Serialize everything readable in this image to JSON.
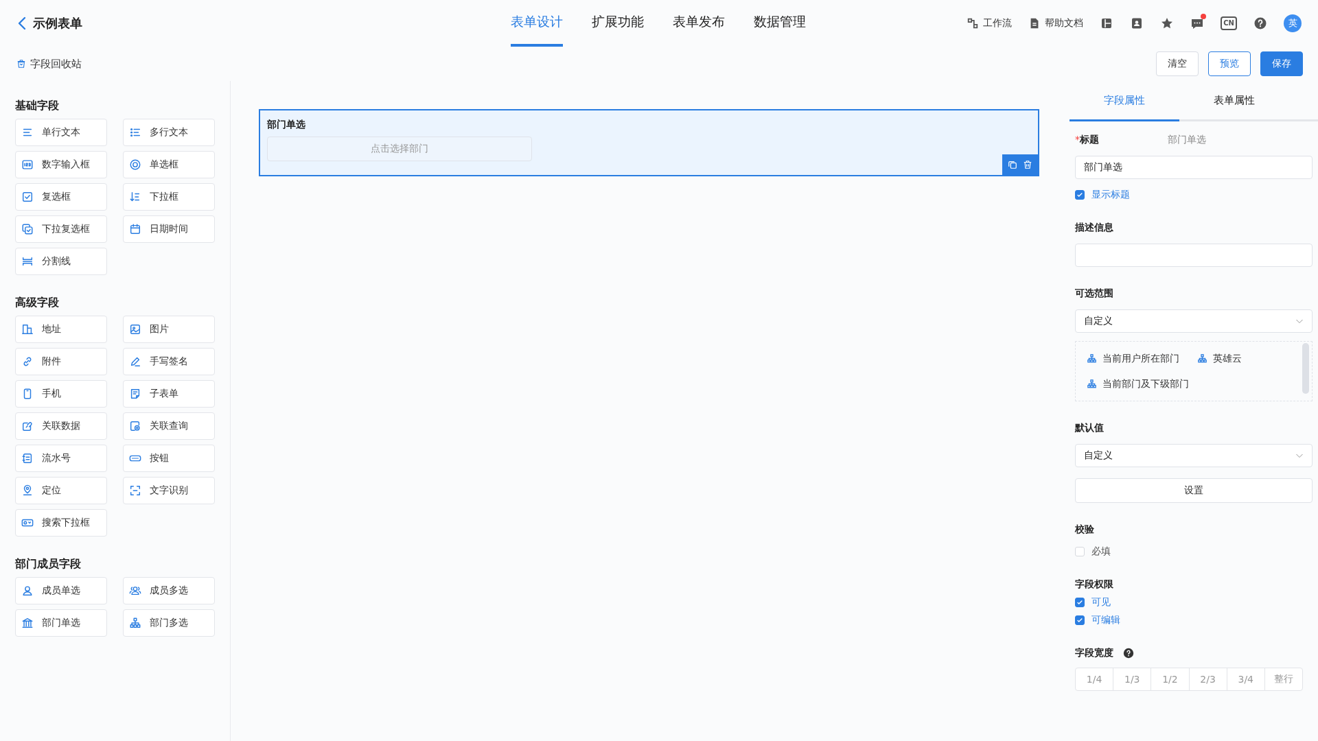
{
  "header": {
    "back_title": "示例表单",
    "nav": [
      {
        "label": "表单设计",
        "selected": true
      },
      {
        "label": "扩展功能",
        "selected": false
      },
      {
        "label": "表单发布",
        "selected": false
      },
      {
        "label": "数据管理",
        "selected": false
      }
    ],
    "tools": [
      {
        "label": "工作流"
      },
      {
        "label": "帮助文档"
      }
    ],
    "notification_dot": true,
    "language": "CN",
    "avatar": "英"
  },
  "toolbar": {
    "recycle": "字段回收站",
    "buttons": [
      {
        "label": "清空",
        "kind": "default"
      },
      {
        "label": "预览",
        "kind": "outline"
      },
      {
        "label": "保存",
        "kind": "primary"
      }
    ]
  },
  "palette": [
    {
      "title": "基础字段",
      "items": [
        "单行文本",
        "多行文本",
        "数字输入框",
        "单选框",
        "复选框",
        "下拉框",
        "下拉复选框",
        "日期时间",
        "分割线"
      ]
    },
    {
      "title": "高级字段",
      "items": [
        "地址",
        "图片",
        "附件",
        "手写签名",
        "手机",
        "子表单",
        "关联数据",
        "关联查询",
        "流水号",
        "按钮",
        "定位",
        "文字识别",
        "搜索下拉框"
      ]
    },
    {
      "title": "部门成员字段",
      "items": [
        "成员单选",
        "成员多选",
        "部门单选",
        "部门多选"
      ]
    }
  ],
  "canvas": {
    "fields": [
      {
        "label": "部门单选",
        "placeholder": "点击选择部门",
        "selected": true
      }
    ]
  },
  "properties": {
    "tabs": [
      {
        "label": "字段属性",
        "selected": true
      },
      {
        "label": "表单属性",
        "selected": false
      }
    ],
    "title": {
      "label": "标题",
      "required_mark": "*",
      "hint": "部门单选",
      "value": "部门单选"
    },
    "show_title": {
      "label": "显示标题",
      "checked": true
    },
    "description": {
      "label": "描述信息"
    },
    "range": {
      "label": "可选范围",
      "value": "自定义",
      "options": [
        "当前用户所在部门",
        "英雄云",
        "当前部门及下级部门"
      ]
    },
    "default": {
      "label": "默认值",
      "value": "自定义",
      "button": "设置"
    },
    "validation": {
      "label": "校验",
      "items": [
        {
          "label": "必填",
          "checked": false
        }
      ]
    },
    "permissions": {
      "label": "字段权限",
      "items": [
        {
          "label": "可见",
          "checked": true
        },
        {
          "label": "可编辑",
          "checked": true
        }
      ]
    },
    "width": {
      "label": "字段宽度",
      "options": [
        {
          "label": "1/4",
          "selected": false
        },
        {
          "label": "1/3",
          "selected": false
        },
        {
          "label": "1/2",
          "selected": false
        },
        {
          "label": "2/3",
          "selected": false
        },
        {
          "label": "3/4",
          "selected": false
        },
        {
          "label": "整行",
          "selected": false
        }
      ]
    }
  }
}
